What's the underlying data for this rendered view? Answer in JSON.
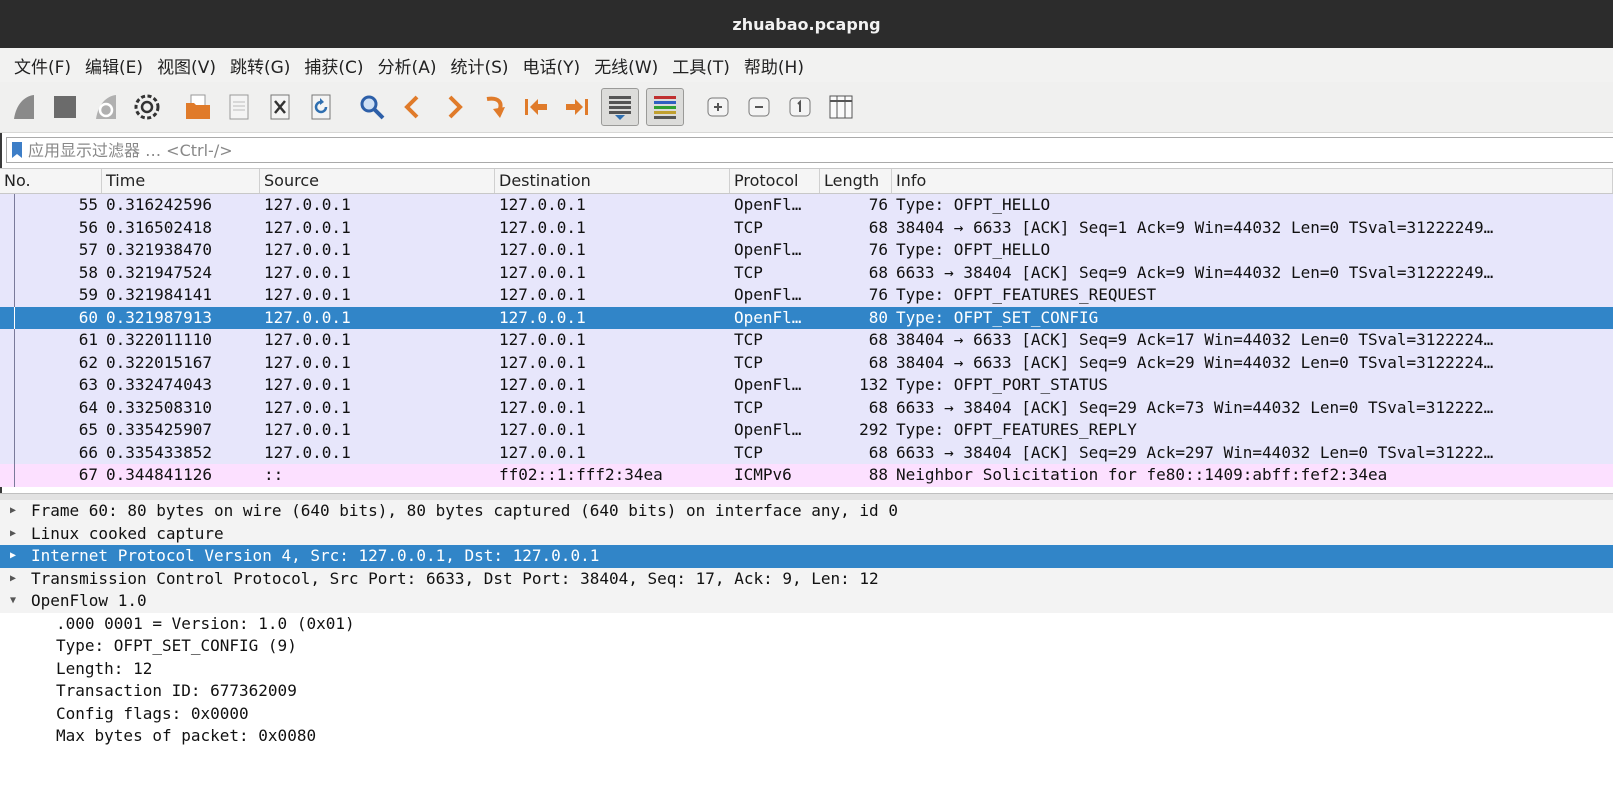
{
  "window": {
    "title": "zhuabao.pcapng"
  },
  "menu": [
    "文件(F)",
    "编辑(E)",
    "视图(V)",
    "跳转(G)",
    "捕获(C)",
    "分析(A)",
    "统计(S)",
    "电话(Y)",
    "无线(W)",
    "工具(T)",
    "帮助(H)"
  ],
  "toolbar": {
    "buttons": [
      {
        "name": "start-capture-icon",
        "color": "#7a7a7a"
      },
      {
        "name": "stop-capture-icon",
        "color": "#6b6b6b"
      },
      {
        "name": "restart-capture-icon",
        "color": "#8a8a8a"
      },
      {
        "name": "capture-options-icon",
        "color": "#333333"
      },
      {
        "name": "open-file-icon",
        "color": "#e07b2a"
      },
      {
        "name": "save-file-icon",
        "color": "#9a9a9a"
      },
      {
        "name": "close-file-icon",
        "color": "#444444"
      },
      {
        "name": "reload-file-icon",
        "color": "#2f6fb0"
      },
      {
        "name": "find-packet-icon",
        "color": "#2d5fa8"
      },
      {
        "name": "go-back-icon",
        "color": "#e07b2a"
      },
      {
        "name": "go-forward-icon",
        "color": "#e07b2a"
      },
      {
        "name": "go-to-packet-icon",
        "color": "#e07b2a"
      },
      {
        "name": "go-first-packet-icon",
        "color": "#e07b2a"
      },
      {
        "name": "go-last-packet-icon",
        "color": "#e07b2a"
      },
      {
        "name": "auto-scroll-icon",
        "color": "#2f6fb0"
      },
      {
        "name": "colorize-icon",
        "color": "#c03030"
      },
      {
        "name": "zoom-in-icon",
        "color": "#666666"
      },
      {
        "name": "zoom-out-icon",
        "color": "#666666"
      },
      {
        "name": "zoom-normal-icon",
        "color": "#666666"
      },
      {
        "name": "resize-columns-icon",
        "color": "#444444"
      }
    ]
  },
  "filter": {
    "placeholder": "应用显示过滤器 … <Ctrl-/>"
  },
  "packet_list": {
    "columns": [
      "No.",
      "Time",
      "Source",
      "Destination",
      "Protocol",
      "Length",
      "Info"
    ],
    "rows": [
      {
        "no": "55",
        "time": "0.316242596",
        "src": "127.0.0.1",
        "dst": "127.0.0.1",
        "proto": "OpenFl…",
        "len": "76",
        "info": "Type: OFPT_HELLO",
        "bg": "#e7e6fb"
      },
      {
        "no": "56",
        "time": "0.316502418",
        "src": "127.0.0.1",
        "dst": "127.0.0.1",
        "proto": "TCP",
        "len": "68",
        "info": "38404 → 6633 [ACK] Seq=1 Ack=9 Win=44032 Len=0 TSval=31222249…",
        "bg": "#e7e6fb"
      },
      {
        "no": "57",
        "time": "0.321938470",
        "src": "127.0.0.1",
        "dst": "127.0.0.1",
        "proto": "OpenFl…",
        "len": "76",
        "info": "Type: OFPT_HELLO",
        "bg": "#e7e6fb"
      },
      {
        "no": "58",
        "time": "0.321947524",
        "src": "127.0.0.1",
        "dst": "127.0.0.1",
        "proto": "TCP",
        "len": "68",
        "info": "6633 → 38404 [ACK] Seq=9 Ack=9 Win=44032 Len=0 TSval=31222249…",
        "bg": "#e7e6fb"
      },
      {
        "no": "59",
        "time": "0.321984141",
        "src": "127.0.0.1",
        "dst": "127.0.0.1",
        "proto": "OpenFl…",
        "len": "76",
        "info": "Type: OFPT_FEATURES_REQUEST",
        "bg": "#e7e6fb"
      },
      {
        "no": "60",
        "time": "0.321987913",
        "src": "127.0.0.1",
        "dst": "127.0.0.1",
        "proto": "OpenFl…",
        "len": "80",
        "info": "Type: OFPT_SET_CONFIG",
        "bg": "#3185c8",
        "selected": true
      },
      {
        "no": "61",
        "time": "0.322011110",
        "src": "127.0.0.1",
        "dst": "127.0.0.1",
        "proto": "TCP",
        "len": "68",
        "info": "38404 → 6633 [ACK] Seq=9 Ack=17 Win=44032 Len=0 TSval=3122224…",
        "bg": "#e7e6fb"
      },
      {
        "no": "62",
        "time": "0.322015167",
        "src": "127.0.0.1",
        "dst": "127.0.0.1",
        "proto": "TCP",
        "len": "68",
        "info": "38404 → 6633 [ACK] Seq=9 Ack=29 Win=44032 Len=0 TSval=3122224…",
        "bg": "#e7e6fb"
      },
      {
        "no": "63",
        "time": "0.332474043",
        "src": "127.0.0.1",
        "dst": "127.0.0.1",
        "proto": "OpenFl…",
        "len": "132",
        "info": "Type: OFPT_PORT_STATUS",
        "bg": "#e7e6fb"
      },
      {
        "no": "64",
        "time": "0.332508310",
        "src": "127.0.0.1",
        "dst": "127.0.0.1",
        "proto": "TCP",
        "len": "68",
        "info": "6633 → 38404 [ACK] Seq=29 Ack=73 Win=44032 Len=0 TSval=312222…",
        "bg": "#e7e6fb"
      },
      {
        "no": "65",
        "time": "0.335425907",
        "src": "127.0.0.1",
        "dst": "127.0.0.1",
        "proto": "OpenFl…",
        "len": "292",
        "info": "Type: OFPT_FEATURES_REPLY",
        "bg": "#e7e6fb"
      },
      {
        "no": "66",
        "time": "0.335433852",
        "src": "127.0.0.1",
        "dst": "127.0.0.1",
        "proto": "TCP",
        "len": "68",
        "info": "6633 → 38404 [ACK] Seq=29 Ack=297 Win=44032 Len=0 TSval=31222…",
        "bg": "#e7e6fb"
      },
      {
        "no": "67",
        "time": "0.344841126",
        "src": "::",
        "dst": "ff02::1:fff2:34ea",
        "proto": "ICMPv6",
        "len": "88",
        "info": "Neighbor Solicitation for fe80::1409:abff:fef2:34ea",
        "bg": "#fce0ff"
      }
    ]
  },
  "details": {
    "top": [
      {
        "text": "Frame 60: 80 bytes on wire (640 bits), 80 bytes captured (640 bits) on interface any, id 0",
        "expanded": false
      },
      {
        "text": "Linux cooked capture",
        "expanded": false
      },
      {
        "text": "Internet Protocol Version 4, Src: 127.0.0.1, Dst: 127.0.0.1",
        "expanded": false,
        "selected": true
      },
      {
        "text": "Transmission Control Protocol, Src Port: 6633, Dst Port: 38404, Seq: 17, Ack: 9, Len: 12",
        "expanded": false
      },
      {
        "text": "OpenFlow 1.0",
        "expanded": true
      }
    ],
    "openflow_fields": [
      ".000 0001 = Version: 1.0 (0x01)",
      "Type: OFPT_SET_CONFIG (9)",
      "Length: 12",
      "Transaction ID: 677362009",
      "Config flags: 0x0000",
      "Max bytes of packet: 0x0080"
    ]
  }
}
